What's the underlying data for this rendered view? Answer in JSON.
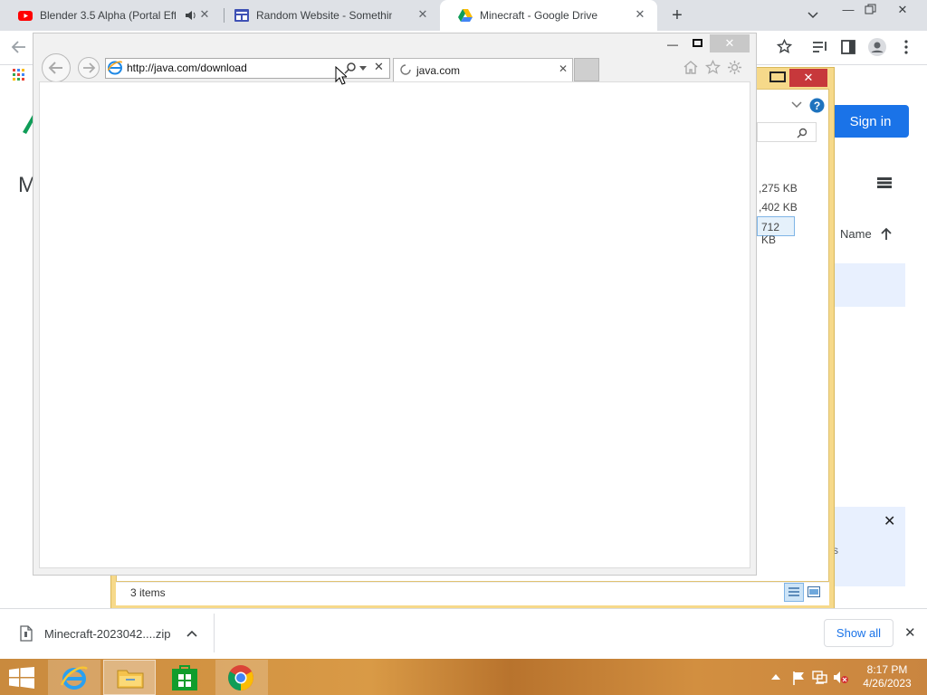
{
  "chrome": {
    "tabs": [
      {
        "title": "Blender 3.5 Alpha (Portal Effe",
        "icon": "youtube-icon"
      },
      {
        "title": "Random Website - Something",
        "icon": "website-icon"
      },
      {
        "title": "Minecraft - Google Drive",
        "icon": "google-drive-icon",
        "active": true
      }
    ],
    "new_tab": "+",
    "signin_label": "Sign in"
  },
  "drive": {
    "heading_fragment": "M",
    "sizes": [
      ",275 KB",
      ",402 KB",
      "712 KB"
    ],
    "sort_label": "Name",
    "fragment_s": "s"
  },
  "explorer": {
    "status": "3 items"
  },
  "ie": {
    "address": "http://java.com/download",
    "tab_title": "java.com"
  },
  "download_bar": {
    "file": "Minecraft-2023042....zip",
    "show_all": "Show all"
  },
  "taskbar": {
    "time": "8:17 PM",
    "date": "4/26/2023"
  },
  "colors": {
    "chrome_tabstrip": "#dee1e6",
    "signin_blue": "#1a73e8",
    "explorer_frame": "#f6d98a",
    "taskbar": "#c98a3e"
  }
}
